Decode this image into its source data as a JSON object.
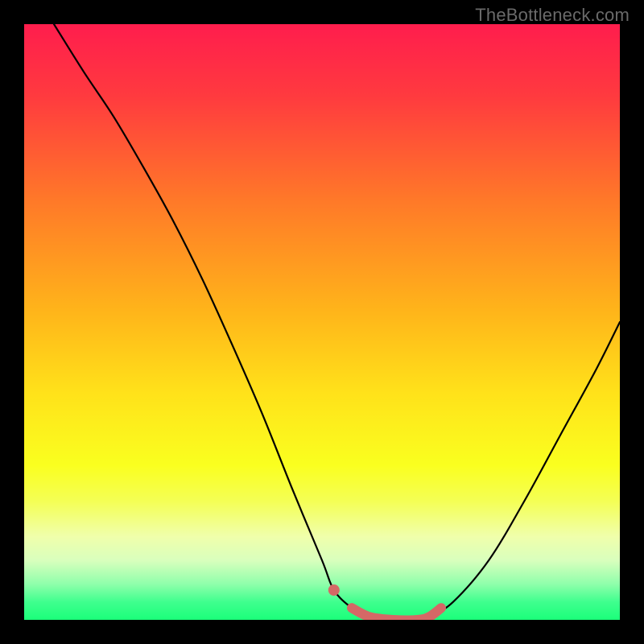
{
  "watermark": {
    "text": "TheBottleneck.com"
  },
  "chart_data": {
    "type": "line",
    "title": "",
    "xlabel": "",
    "ylabel": "",
    "ylim": [
      0,
      100
    ],
    "xlim": [
      0,
      100
    ],
    "series": [
      {
        "name": "curve",
        "x": [
          5,
          10,
          15,
          20,
          25,
          30,
          35,
          40,
          45,
          50,
          52,
          55,
          58,
          62,
          66,
          68,
          72,
          78,
          84,
          90,
          96,
          100
        ],
        "y": [
          100,
          92,
          84.5,
          76,
          67,
          57,
          46,
          34.5,
          22,
          10,
          5,
          2,
          0.5,
          0,
          0,
          0.5,
          3,
          10,
          20,
          31,
          42,
          50
        ]
      },
      {
        "name": "highlight",
        "x": [
          52,
          55,
          58,
          62,
          66,
          68,
          70
        ],
        "y": [
          5,
          2,
          0.5,
          0,
          0,
          0.5,
          2
        ]
      }
    ],
    "gradient_stops": [
      {
        "offset": 0.0,
        "color": "#ff1d4d"
      },
      {
        "offset": 0.12,
        "color": "#ff3a3f"
      },
      {
        "offset": 0.3,
        "color": "#ff7a28"
      },
      {
        "offset": 0.48,
        "color": "#ffb41a"
      },
      {
        "offset": 0.62,
        "color": "#ffe21a"
      },
      {
        "offset": 0.74,
        "color": "#faff1f"
      },
      {
        "offset": 0.8,
        "color": "#f4ff54"
      },
      {
        "offset": 0.86,
        "color": "#f0ffab"
      },
      {
        "offset": 0.9,
        "color": "#d9ffbd"
      },
      {
        "offset": 0.94,
        "color": "#8fffab"
      },
      {
        "offset": 0.97,
        "color": "#3fff8e"
      },
      {
        "offset": 1.0,
        "color": "#1bff7a"
      }
    ],
    "highlight_style": {
      "stroke": "#d56866",
      "width": 12,
      "dot_radius": 7
    }
  }
}
